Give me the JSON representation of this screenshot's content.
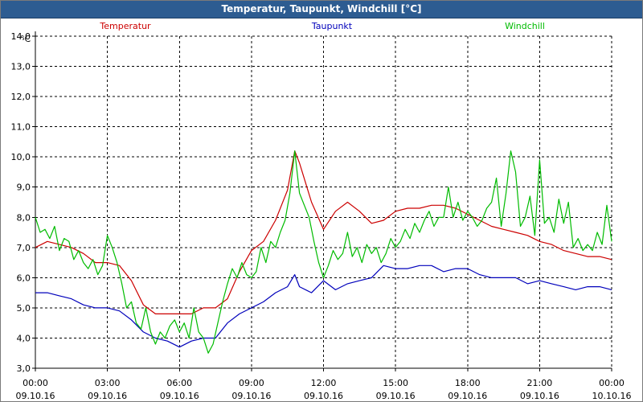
{
  "window": {
    "title": "Temperatur, Taupunkt, Windchill [°C]"
  },
  "chart_data": {
    "type": "line",
    "title": "Temperatur, Taupunkt, Windchill [°C]",
    "ylabel": "°C",
    "xlabel": "",
    "ylim": [
      3.0,
      14.0
    ],
    "xlim": [
      0,
      24
    ],
    "grid": true,
    "y_ticks": [
      "3,0",
      "4,0",
      "5,0",
      "6,0",
      "7,0",
      "8,0",
      "9,0",
      "10,0",
      "11,0",
      "12,0",
      "13,0",
      "14,0"
    ],
    "x_ticks": [
      {
        "time": "00:00",
        "date": "09.10.16"
      },
      {
        "time": "03:00",
        "date": "09.10.16"
      },
      {
        "time": "06:00",
        "date": "09.10.16"
      },
      {
        "time": "09:00",
        "date": "09.10.16"
      },
      {
        "time": "12:00",
        "date": "09.10.16"
      },
      {
        "time": "15:00",
        "date": "09.10.16"
      },
      {
        "time": "18:00",
        "date": "09.10.16"
      },
      {
        "time": "21:00",
        "date": "09.10.16"
      },
      {
        "time": "00:00",
        "date": "10.10.16"
      }
    ],
    "series": [
      {
        "name": "Temperatur",
        "color": "#cc0000",
        "points": [
          [
            0,
            7.0
          ],
          [
            0.5,
            7.2
          ],
          [
            1,
            7.1
          ],
          [
            1.5,
            7.0
          ],
          [
            2,
            6.8
          ],
          [
            2.5,
            6.5
          ],
          [
            3,
            6.5
          ],
          [
            3.5,
            6.4
          ],
          [
            4,
            5.9
          ],
          [
            4.5,
            5.1
          ],
          [
            5,
            4.8
          ],
          [
            5.5,
            4.8
          ],
          [
            6,
            4.8
          ],
          [
            6.5,
            4.8
          ],
          [
            7,
            5.0
          ],
          [
            7.5,
            5.0
          ],
          [
            8,
            5.3
          ],
          [
            8.5,
            6.2
          ],
          [
            9,
            6.9
          ],
          [
            9.5,
            7.2
          ],
          [
            10,
            7.9
          ],
          [
            10.5,
            8.9
          ],
          [
            10.8,
            10.2
          ],
          [
            11,
            9.8
          ],
          [
            11.5,
            8.5
          ],
          [
            12,
            7.6
          ],
          [
            12.5,
            8.2
          ],
          [
            13,
            8.5
          ],
          [
            13.5,
            8.2
          ],
          [
            14,
            7.8
          ],
          [
            14.5,
            7.9
          ],
          [
            15,
            8.2
          ],
          [
            15.5,
            8.3
          ],
          [
            16,
            8.3
          ],
          [
            16.5,
            8.4
          ],
          [
            17,
            8.4
          ],
          [
            17.5,
            8.3
          ],
          [
            18,
            8.1
          ],
          [
            18.5,
            7.9
          ],
          [
            19,
            7.7
          ],
          [
            19.5,
            7.6
          ],
          [
            20,
            7.5
          ],
          [
            20.5,
            7.4
          ],
          [
            21,
            7.2
          ],
          [
            21.5,
            7.1
          ],
          [
            22,
            6.9
          ],
          [
            22.5,
            6.8
          ],
          [
            23,
            6.7
          ],
          [
            23.5,
            6.7
          ],
          [
            24,
            6.6
          ]
        ]
      },
      {
        "name": "Taupunkt",
        "color": "#0000bb",
        "points": [
          [
            0,
            5.5
          ],
          [
            0.5,
            5.5
          ],
          [
            1,
            5.4
          ],
          [
            1.5,
            5.3
          ],
          [
            2,
            5.1
          ],
          [
            2.5,
            5.0
          ],
          [
            3,
            5.0
          ],
          [
            3.5,
            4.9
          ],
          [
            4,
            4.6
          ],
          [
            4.5,
            4.2
          ],
          [
            5,
            4.0
          ],
          [
            5.5,
            3.9
          ],
          [
            6,
            3.7
          ],
          [
            6.5,
            3.9
          ],
          [
            7,
            4.0
          ],
          [
            7.5,
            4.0
          ],
          [
            8,
            4.5
          ],
          [
            8.5,
            4.8
          ],
          [
            9,
            5.0
          ],
          [
            9.5,
            5.2
          ],
          [
            10,
            5.5
          ],
          [
            10.5,
            5.7
          ],
          [
            10.8,
            6.1
          ],
          [
            11,
            5.7
          ],
          [
            11.5,
            5.5
          ],
          [
            12,
            5.9
          ],
          [
            12.5,
            5.6
          ],
          [
            13,
            5.8
          ],
          [
            13.5,
            5.9
          ],
          [
            14,
            6.0
          ],
          [
            14.5,
            6.4
          ],
          [
            15,
            6.3
          ],
          [
            15.5,
            6.3
          ],
          [
            16,
            6.4
          ],
          [
            16.5,
            6.4
          ],
          [
            17,
            6.2
          ],
          [
            17.5,
            6.3
          ],
          [
            18,
            6.3
          ],
          [
            18.5,
            6.1
          ],
          [
            19,
            6.0
          ],
          [
            19.5,
            6.0
          ],
          [
            20,
            6.0
          ],
          [
            20.5,
            5.8
          ],
          [
            21,
            5.9
          ],
          [
            21.5,
            5.8
          ],
          [
            22,
            5.7
          ],
          [
            22.5,
            5.6
          ],
          [
            23,
            5.7
          ],
          [
            23.5,
            5.7
          ],
          [
            24,
            5.6
          ]
        ]
      },
      {
        "name": "Windchill",
        "color": "#00bb00",
        "points": [
          [
            0,
            8.0
          ],
          [
            0.2,
            7.5
          ],
          [
            0.4,
            7.6
          ],
          [
            0.6,
            7.3
          ],
          [
            0.8,
            7.7
          ],
          [
            1,
            6.9
          ],
          [
            1.2,
            7.3
          ],
          [
            1.4,
            7.2
          ],
          [
            1.6,
            6.6
          ],
          [
            1.8,
            6.9
          ],
          [
            2,
            6.5
          ],
          [
            2.2,
            6.3
          ],
          [
            2.4,
            6.6
          ],
          [
            2.6,
            6.1
          ],
          [
            2.8,
            6.4
          ],
          [
            3,
            7.4
          ],
          [
            3.2,
            7.0
          ],
          [
            3.4,
            6.5
          ],
          [
            3.6,
            5.8
          ],
          [
            3.8,
            5.0
          ],
          [
            4,
            5.2
          ],
          [
            4.2,
            4.5
          ],
          [
            4.4,
            4.3
          ],
          [
            4.6,
            5.0
          ],
          [
            4.8,
            4.2
          ],
          [
            5,
            3.8
          ],
          [
            5.2,
            4.2
          ],
          [
            5.4,
            4.0
          ],
          [
            5.6,
            4.4
          ],
          [
            5.8,
            4.6
          ],
          [
            6,
            4.2
          ],
          [
            6.2,
            4.5
          ],
          [
            6.4,
            4.0
          ],
          [
            6.6,
            5.0
          ],
          [
            6.8,
            4.2
          ],
          [
            7,
            4.0
          ],
          [
            7.2,
            3.5
          ],
          [
            7.4,
            3.8
          ],
          [
            7.6,
            4.5
          ],
          [
            7.8,
            5.2
          ],
          [
            8,
            5.8
          ],
          [
            8.2,
            6.3
          ],
          [
            8.4,
            6.0
          ],
          [
            8.6,
            6.5
          ],
          [
            8.8,
            6.1
          ],
          [
            9,
            6.0
          ],
          [
            9.2,
            6.2
          ],
          [
            9.4,
            7.0
          ],
          [
            9.6,
            6.5
          ],
          [
            9.8,
            7.2
          ],
          [
            10,
            7.0
          ],
          [
            10.2,
            7.5
          ],
          [
            10.4,
            7.9
          ],
          [
            10.6,
            8.8
          ],
          [
            10.8,
            10.2
          ],
          [
            11,
            8.8
          ],
          [
            11.2,
            8.4
          ],
          [
            11.4,
            8.0
          ],
          [
            11.6,
            7.2
          ],
          [
            11.8,
            6.5
          ],
          [
            12,
            6.0
          ],
          [
            12.2,
            6.4
          ],
          [
            12.4,
            6.9
          ],
          [
            12.6,
            6.6
          ],
          [
            12.8,
            6.8
          ],
          [
            13,
            7.5
          ],
          [
            13.2,
            6.7
          ],
          [
            13.4,
            7.0
          ],
          [
            13.6,
            6.5
          ],
          [
            13.8,
            7.1
          ],
          [
            14,
            6.8
          ],
          [
            14.2,
            7.0
          ],
          [
            14.4,
            6.5
          ],
          [
            14.6,
            6.8
          ],
          [
            14.8,
            7.3
          ],
          [
            15,
            7.0
          ],
          [
            15.2,
            7.2
          ],
          [
            15.4,
            7.6
          ],
          [
            15.6,
            7.3
          ],
          [
            15.8,
            7.8
          ],
          [
            16,
            7.5
          ],
          [
            16.2,
            7.9
          ],
          [
            16.4,
            8.2
          ],
          [
            16.6,
            7.7
          ],
          [
            16.8,
            8.0
          ],
          [
            17,
            8.0
          ],
          [
            17.2,
            9.0
          ],
          [
            17.4,
            8.0
          ],
          [
            17.6,
            8.5
          ],
          [
            17.8,
            7.9
          ],
          [
            18,
            8.2
          ],
          [
            18.2,
            8.0
          ],
          [
            18.4,
            7.7
          ],
          [
            18.6,
            7.9
          ],
          [
            18.8,
            8.3
          ],
          [
            19,
            8.5
          ],
          [
            19.2,
            9.3
          ],
          [
            19.4,
            7.7
          ],
          [
            19.6,
            8.8
          ],
          [
            19.8,
            10.2
          ],
          [
            20,
            9.5
          ],
          [
            20.2,
            7.7
          ],
          [
            20.4,
            8.0
          ],
          [
            20.6,
            8.7
          ],
          [
            20.8,
            7.4
          ],
          [
            21,
            9.9
          ],
          [
            21.2,
            7.8
          ],
          [
            21.4,
            8.0
          ],
          [
            21.6,
            7.5
          ],
          [
            21.8,
            8.6
          ],
          [
            22,
            7.8
          ],
          [
            22.2,
            8.5
          ],
          [
            22.4,
            7.0
          ],
          [
            22.6,
            7.3
          ],
          [
            22.8,
            6.9
          ],
          [
            23,
            7.1
          ],
          [
            23.2,
            6.9
          ],
          [
            23.4,
            7.5
          ],
          [
            23.6,
            7.1
          ],
          [
            23.8,
            8.4
          ],
          [
            24,
            7.2
          ]
        ]
      }
    ]
  }
}
